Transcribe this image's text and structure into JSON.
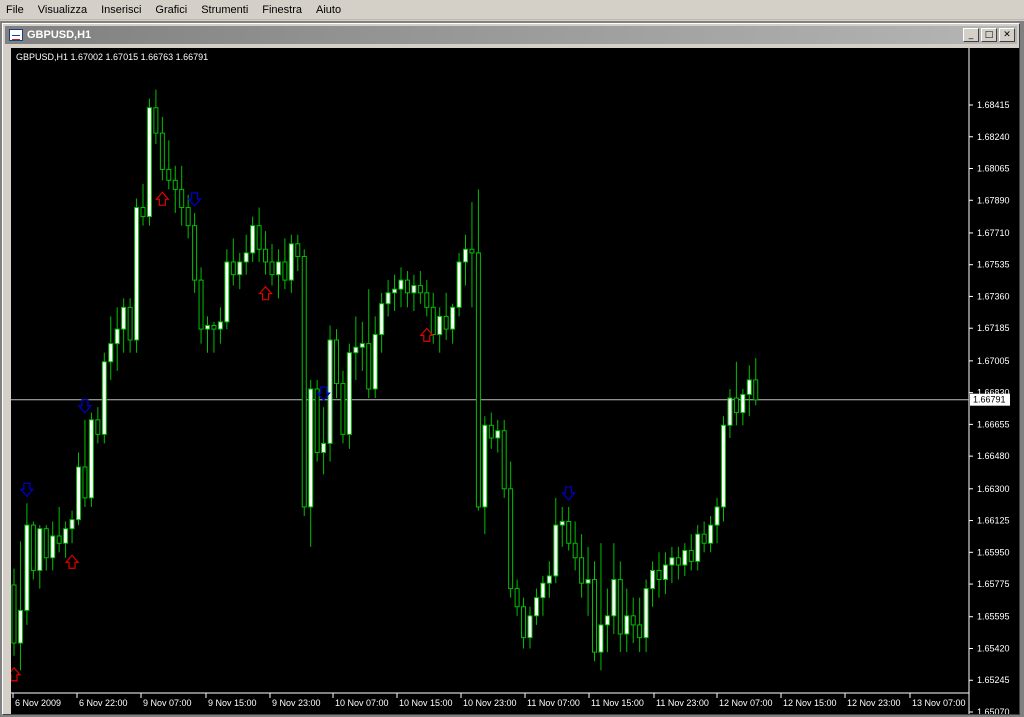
{
  "menu": [
    "File",
    "Visualizza",
    "Inserisci",
    "Grafici",
    "Strumenti",
    "Finestra",
    "Aiuto"
  ],
  "window": {
    "title": "GBPUSD,H1"
  },
  "chart_data": {
    "type": "candlestick",
    "symbol": "GBPUSD",
    "timeframe": "H1",
    "header_text": "GBPUSD,H1  1.67002 1.67015 1.66763 1.66791",
    "current_price": "1.66791",
    "y_ticks": [
      "1.68415",
      "1.68240",
      "1.68065",
      "1.67890",
      "1.67710",
      "1.67535",
      "1.67360",
      "1.67185",
      "1.67005",
      "1.66830",
      "1.66655",
      "1.66480",
      "1.66300",
      "1.66125",
      "1.65950",
      "1.65775",
      "1.65595",
      "1.65420",
      "1.65245",
      "1.65070"
    ],
    "y_tick_values": [
      1.68415,
      1.6824,
      1.68065,
      1.6789,
      1.6771,
      1.67535,
      1.6736,
      1.67185,
      1.67005,
      1.6683,
      1.66655,
      1.6648,
      1.663,
      1.66125,
      1.6595,
      1.65775,
      1.65595,
      1.6542,
      1.65245,
      1.6507
    ],
    "x_ticks": [
      "6 Nov 2009",
      "6 Nov 22:00",
      "9 Nov 07:00",
      "9 Nov 15:00",
      "9 Nov 23:00",
      "10 Nov 07:00",
      "10 Nov 15:00",
      "10 Nov 23:00",
      "11 Nov 07:00",
      "11 Nov 15:00",
      "11 Nov 23:00",
      "12 Nov 07:00",
      "12 Nov 15:00",
      "12 Nov 23:00",
      "13 Nov 07:00"
    ],
    "colors": {
      "background": "#000000",
      "candle": "#00c000",
      "bull_body": "#ffffff",
      "bear_body": "#000000",
      "down_arrow": "#0000cd",
      "up_arrow": "#e00000",
      "price_line": "#c0c0c0"
    },
    "candles": [
      [
        1.6577,
        1.6586,
        1.6538,
        1.6545
      ],
      [
        1.6545,
        1.6601,
        1.653,
        1.6563
      ],
      [
        1.6563,
        1.6622,
        1.6555,
        1.661
      ],
      [
        1.661,
        1.6612,
        1.658,
        1.6585
      ],
      [
        1.6585,
        1.661,
        1.6575,
        1.6608
      ],
      [
        1.6608,
        1.661,
        1.6585,
        1.6592
      ],
      [
        1.6592,
        1.6612,
        1.6585,
        1.6604
      ],
      [
        1.6604,
        1.662,
        1.6595,
        1.66
      ],
      [
        1.66,
        1.6612,
        1.6592,
        1.6608
      ],
      [
        1.6608,
        1.6618,
        1.66,
        1.6613
      ],
      [
        1.6613,
        1.665,
        1.661,
        1.6642
      ],
      [
        1.6642,
        1.6668,
        1.662,
        1.6625
      ],
      [
        1.6625,
        1.6672,
        1.662,
        1.6668
      ],
      [
        1.6668,
        1.6675,
        1.6655,
        1.666
      ],
      [
        1.666,
        1.6705,
        1.6655,
        1.67
      ],
      [
        1.67,
        1.6725,
        1.669,
        1.671
      ],
      [
        1.671,
        1.673,
        1.6695,
        1.6718
      ],
      [
        1.6718,
        1.6735,
        1.6705,
        1.673
      ],
      [
        1.673,
        1.6735,
        1.6705,
        1.6712
      ],
      [
        1.6712,
        1.679,
        1.6705,
        1.6785
      ],
      [
        1.6785,
        1.6798,
        1.6775,
        1.678
      ],
      [
        1.678,
        1.6845,
        1.6775,
        1.684
      ],
      [
        1.684,
        1.685,
        1.682,
        1.6826
      ],
      [
        1.6826,
        1.6835,
        1.68,
        1.6806
      ],
      [
        1.6806,
        1.6822,
        1.6795,
        1.68
      ],
      [
        1.68,
        1.6808,
        1.6782,
        1.6795
      ],
      [
        1.6795,
        1.6808,
        1.6775,
        1.6785
      ],
      [
        1.6785,
        1.6792,
        1.6768,
        1.6775
      ],
      [
        1.6775,
        1.6782,
        1.6738,
        1.6745
      ],
      [
        1.6745,
        1.6752,
        1.671,
        1.6718
      ],
      [
        1.6718,
        1.6725,
        1.6705,
        1.672
      ],
      [
        1.672,
        1.6722,
        1.6705,
        1.6718
      ],
      [
        1.6718,
        1.673,
        1.671,
        1.6722
      ],
      [
        1.6722,
        1.6762,
        1.6718,
        1.6755
      ],
      [
        1.6755,
        1.6768,
        1.6742,
        1.6748
      ],
      [
        1.6748,
        1.676,
        1.674,
        1.6755
      ],
      [
        1.6755,
        1.677,
        1.6748,
        1.676
      ],
      [
        1.676,
        1.678,
        1.6755,
        1.6775
      ],
      [
        1.6775,
        1.6785,
        1.6755,
        1.6762
      ],
      [
        1.6762,
        1.6772,
        1.6748,
        1.6755
      ],
      [
        1.6755,
        1.6765,
        1.6742,
        1.6748
      ],
      [
        1.6748,
        1.6762,
        1.6735,
        1.6755
      ],
      [
        1.6755,
        1.6768,
        1.674,
        1.6745
      ],
      [
        1.6745,
        1.677,
        1.6738,
        1.6765
      ],
      [
        1.6765,
        1.677,
        1.675,
        1.6758
      ],
      [
        1.6758,
        1.6762,
        1.6615,
        1.662
      ],
      [
        1.662,
        1.669,
        1.6598,
        1.6685
      ],
      [
        1.6685,
        1.669,
        1.6645,
        1.665
      ],
      [
        1.665,
        1.6675,
        1.6638,
        1.6655
      ],
      [
        1.6655,
        1.672,
        1.6645,
        1.6712
      ],
      [
        1.6712,
        1.6718,
        1.668,
        1.6688
      ],
      [
        1.6688,
        1.6695,
        1.6655,
        1.666
      ],
      [
        1.666,
        1.671,
        1.6652,
        1.6705
      ],
      [
        1.6705,
        1.6725,
        1.669,
        1.6708
      ],
      [
        1.6708,
        1.6722,
        1.6695,
        1.671
      ],
      [
        1.671,
        1.674,
        1.668,
        1.6685
      ],
      [
        1.6685,
        1.6725,
        1.668,
        1.6715
      ],
      [
        1.6715,
        1.6738,
        1.6705,
        1.6732
      ],
      [
        1.6732,
        1.6745,
        1.6725,
        1.6738
      ],
      [
        1.6738,
        1.6748,
        1.6728,
        1.674
      ],
      [
        1.674,
        1.6752,
        1.673,
        1.6745
      ],
      [
        1.6745,
        1.675,
        1.673,
        1.6738
      ],
      [
        1.6738,
        1.6748,
        1.6728,
        1.6742
      ],
      [
        1.6742,
        1.675,
        1.6732,
        1.6738
      ],
      [
        1.6738,
        1.6745,
        1.6725,
        1.673
      ],
      [
        1.673,
        1.6738,
        1.671,
        1.6715
      ],
      [
        1.6715,
        1.673,
        1.6705,
        1.6725
      ],
      [
        1.6725,
        1.6738,
        1.6712,
        1.6718
      ],
      [
        1.6718,
        1.6732,
        1.671,
        1.673
      ],
      [
        1.673,
        1.676,
        1.6725,
        1.6755
      ],
      [
        1.6755,
        1.677,
        1.6742,
        1.6762
      ],
      [
        1.6762,
        1.6788,
        1.673,
        1.676
      ],
      [
        1.676,
        1.6795,
        1.6618,
        1.662
      ],
      [
        1.662,
        1.667,
        1.6605,
        1.6665
      ],
      [
        1.6665,
        1.6672,
        1.6652,
        1.6658
      ],
      [
        1.6658,
        1.6668,
        1.665,
        1.6662
      ],
      [
        1.6662,
        1.6668,
        1.6625,
        1.663
      ],
      [
        1.663,
        1.6645,
        1.657,
        1.6575
      ],
      [
        1.6575,
        1.658,
        1.656,
        1.6565
      ],
      [
        1.6565,
        1.657,
        1.6542,
        1.6548
      ],
      [
        1.6548,
        1.6565,
        1.6542,
        1.656
      ],
      [
        1.656,
        1.6575,
        1.6555,
        1.657
      ],
      [
        1.657,
        1.6582,
        1.656,
        1.6578
      ],
      [
        1.6578,
        1.659,
        1.657,
        1.6582
      ],
      [
        1.6582,
        1.6625,
        1.6578,
        1.661
      ],
      [
        1.661,
        1.662,
        1.6598,
        1.6612
      ],
      [
        1.6612,
        1.662,
        1.6596,
        1.66
      ],
      [
        1.66,
        1.6612,
        1.6585,
        1.6592
      ],
      [
        1.6592,
        1.6605,
        1.657,
        1.6578
      ],
      [
        1.6578,
        1.6598,
        1.656,
        1.658
      ],
      [
        1.658,
        1.659,
        1.6535,
        1.654
      ],
      [
        1.654,
        1.66,
        1.653,
        1.6555
      ],
      [
        1.6555,
        1.6575,
        1.654,
        1.656
      ],
      [
        1.656,
        1.66,
        1.655,
        1.658
      ],
      [
        1.658,
        1.659,
        1.654,
        1.655
      ],
      [
        1.655,
        1.6575,
        1.654,
        1.656
      ],
      [
        1.656,
        1.657,
        1.6545,
        1.6555
      ],
      [
        1.6555,
        1.657,
        1.654,
        1.6548
      ],
      [
        1.6548,
        1.658,
        1.654,
        1.6575
      ],
      [
        1.6575,
        1.659,
        1.6565,
        1.6585
      ],
      [
        1.6585,
        1.6595,
        1.657,
        1.658
      ],
      [
        1.658,
        1.6595,
        1.6572,
        1.6588
      ],
      [
        1.6588,
        1.6598,
        1.6578,
        1.6592
      ],
      [
        1.6592,
        1.6598,
        1.658,
        1.6588
      ],
      [
        1.6588,
        1.66,
        1.6582,
        1.6596
      ],
      [
        1.6596,
        1.6605,
        1.6585,
        1.659
      ],
      [
        1.659,
        1.661,
        1.6585,
        1.6605
      ],
      [
        1.6605,
        1.6612,
        1.6595,
        1.66
      ],
      [
        1.66,
        1.6615,
        1.6595,
        1.661
      ],
      [
        1.661,
        1.6625,
        1.66,
        1.662
      ],
      [
        1.662,
        1.667,
        1.6612,
        1.6665
      ],
      [
        1.6665,
        1.6685,
        1.6658,
        1.668
      ],
      [
        1.668,
        1.67,
        1.6665,
        1.6672
      ],
      [
        1.6672,
        1.6685,
        1.6665,
        1.6682
      ],
      [
        1.6682,
        1.6698,
        1.667,
        1.669
      ],
      [
        1.669,
        1.6702,
        1.6676,
        1.6679
      ]
    ],
    "down_arrows": [
      2,
      11,
      28,
      48,
      86
    ],
    "up_arrows": [
      0,
      9,
      23,
      39,
      64
    ]
  }
}
